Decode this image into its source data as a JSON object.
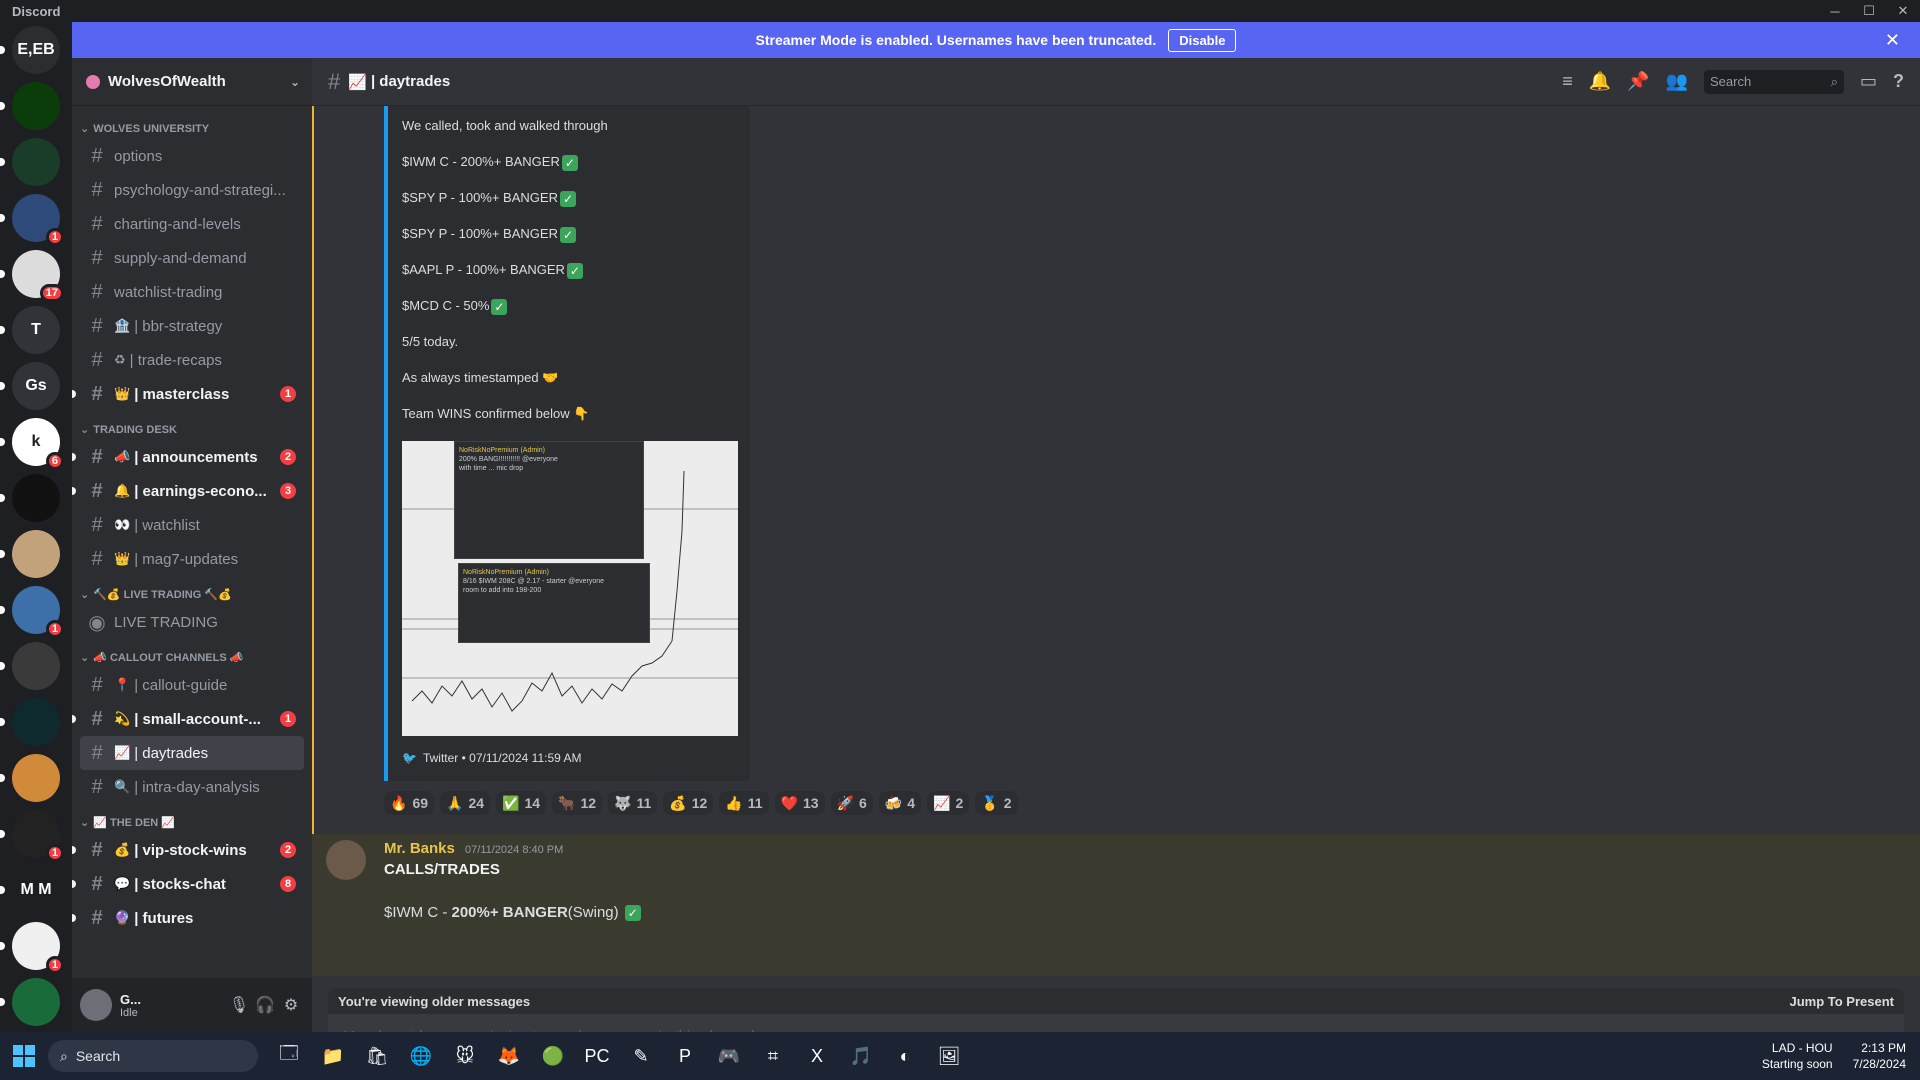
{
  "window": {
    "app_name": "Discord"
  },
  "banner": {
    "text": "Streamer Mode is enabled. Usernames have been truncated.",
    "button": "Disable"
  },
  "guilds": [
    {
      "label": "E,EB",
      "color": "#2b2d31",
      "badge": ""
    },
    {
      "label": "",
      "color": "#0b3d0b",
      "badge": ""
    },
    {
      "label": "",
      "color": "#1a3d2a",
      "badge": ""
    },
    {
      "label": "",
      "color": "#2e4a7a",
      "badge": "1"
    },
    {
      "label": "",
      "color": "#dcdcdc",
      "badge": "17"
    },
    {
      "label": "T",
      "color": "#313338",
      "badge": ""
    },
    {
      "label": "Gs",
      "color": "#313338",
      "badge": ""
    },
    {
      "label": "k",
      "color": "#ffffff",
      "badge": "6"
    },
    {
      "label": "",
      "color": "#111111",
      "badge": ""
    },
    {
      "label": "",
      "color": "#c2a27a",
      "badge": ""
    },
    {
      "label": "",
      "color": "#3d6fa8",
      "badge": "1"
    },
    {
      "label": "",
      "color": "#3a3a3a",
      "badge": ""
    },
    {
      "label": "",
      "color": "#0e2a2f",
      "badge": ""
    },
    {
      "label": "",
      "color": "#d18a3a",
      "badge": ""
    },
    {
      "label": "",
      "color": "#222222",
      "badge": "1"
    },
    {
      "label": "M M",
      "color": "#1e1f22",
      "badge": ""
    },
    {
      "label": "",
      "color": "#f0f0f0",
      "badge": "1"
    },
    {
      "label": "",
      "color": "#1a6b3a",
      "badge": ""
    }
  ],
  "server": {
    "name": "WolvesOfWealth"
  },
  "sidebar": {
    "categories": [
      {
        "name": "WOLVES UNIVERSITY",
        "channels": [
          {
            "label": "options",
            "emoji": "",
            "unread": false,
            "badge": ""
          },
          {
            "label": "psychology-and-strategi...",
            "emoji": "",
            "unread": false,
            "badge": ""
          },
          {
            "label": "charting-and-levels",
            "emoji": "",
            "unread": false,
            "badge": ""
          },
          {
            "label": "supply-and-demand",
            "emoji": "",
            "unread": false,
            "badge": ""
          },
          {
            "label": "watchlist-trading",
            "emoji": "",
            "unread": false,
            "badge": ""
          },
          {
            "label": "| bbr-strategy",
            "emoji": "🏦",
            "unread": false,
            "badge": ""
          },
          {
            "label": "| trade-recaps",
            "emoji": "♻",
            "unread": false,
            "badge": ""
          },
          {
            "label": "| masterclass",
            "emoji": "👑",
            "unread": true,
            "badge": "1"
          }
        ]
      },
      {
        "name": "TRADING DESK",
        "channels": [
          {
            "label": "| announcements",
            "emoji": "📣",
            "unread": true,
            "badge": "2"
          },
          {
            "label": "| earnings-econo...",
            "emoji": "🔔",
            "unread": true,
            "badge": "3"
          },
          {
            "label": "| watchlist",
            "emoji": "👀",
            "unread": false,
            "badge": ""
          },
          {
            "label": "| mag7-updates",
            "emoji": "👑",
            "unread": false,
            "badge": ""
          }
        ]
      },
      {
        "name": "🔨💰 LIVE TRADING 🔨💰",
        "channels": [
          {
            "label": "LIVE TRADING",
            "emoji": "",
            "unread": false,
            "badge": "",
            "voice": true
          }
        ]
      },
      {
        "name": "📣 CALLOUT CHANNELS 📣",
        "channels": [
          {
            "label": "| callout-guide",
            "emoji": "📍",
            "unread": false,
            "badge": ""
          },
          {
            "label": "| small-account-...",
            "emoji": "💫",
            "unread": true,
            "badge": "1"
          },
          {
            "label": "| daytrades",
            "emoji": "📈",
            "unread": false,
            "badge": "",
            "active": true
          },
          {
            "label": "| intra-day-analysis",
            "emoji": "🔍",
            "unread": false,
            "badge": ""
          }
        ]
      },
      {
        "name": "📈 THE DEN 📈",
        "channels": [
          {
            "label": "| vip-stock-wins",
            "emoji": "💰",
            "unread": true,
            "badge": "2"
          },
          {
            "label": "| stocks-chat",
            "emoji": "💬",
            "unread": true,
            "badge": "8"
          },
          {
            "label": "| futures",
            "emoji": "🔮",
            "unread": true,
            "badge": ""
          }
        ]
      }
    ]
  },
  "user": {
    "name": "G...",
    "status": "Idle"
  },
  "channel_header": {
    "name": "| daytrades",
    "search_placeholder": "Search"
  },
  "embed": {
    "lines": [
      "We called, took and walked through",
      "$IWM C - 200%+ BANGER",
      "$SPY P - 100%+ BANGER",
      "$SPY P - 100%+ BANGER",
      "$AAPL P - 100%+ BANGER",
      "$MCD C - 50%",
      "5/5 today.",
      "As always timestamped 🤝",
      "Team WINS confirmed below 👇"
    ],
    "checks": [
      false,
      true,
      true,
      true,
      true,
      true,
      false,
      false,
      false
    ],
    "shot1_author": "NoRiskNoPremium (Admin)",
    "shot1_text": "200% BANG!!!!!!!!!!! @everyone",
    "shot1_sub": "with time ... mic drop",
    "shot2_author": "NoRiskNoPremium (Admin)",
    "shot2_text": "8/16 $IWM 208C @ 2.17 - starter @everyone",
    "shot2_sub": "room to add into 198-200",
    "footer": "Twitter • 07/11/2024 11:59 AM"
  },
  "reactions": [
    {
      "emoji": "🔥",
      "count": "69"
    },
    {
      "emoji": "🙏",
      "count": "24"
    },
    {
      "emoji": "✅",
      "count": "14"
    },
    {
      "emoji": "🐂",
      "count": "12"
    },
    {
      "emoji": "🐺",
      "count": "11"
    },
    {
      "emoji": "💰",
      "count": "12"
    },
    {
      "emoji": "👍",
      "count": "11"
    },
    {
      "emoji": "❤️",
      "count": "13"
    },
    {
      "emoji": "🚀",
      "count": "6"
    },
    {
      "emoji": "🍻",
      "count": "4"
    },
    {
      "emoji": "📈",
      "count": "2"
    },
    {
      "emoji": "🥇",
      "count": "2"
    }
  ],
  "message2": {
    "author": "Mr. Banks",
    "timestamp": "07/11/2024 8:40 PM",
    "line1": "CALLS/TRADES",
    "line2_prefix": "$IWM C - ",
    "line2_bold": "200%+ BANGER",
    "line2_suffix": "(Swing)"
  },
  "older_bar": {
    "text": "You're viewing older messages",
    "jump": "Jump To Present"
  },
  "input": {
    "placeholder": "You do not have permission to send messages in this channel."
  },
  "taskbar": {
    "search": "Search",
    "apps": [
      "🗔",
      "📁",
      "🛍",
      "🌐",
      "🐭",
      "🦊",
      "🟢",
      "PC",
      "✎",
      "P",
      "🎮",
      "⌗",
      "X",
      "🎵",
      "◐",
      "🖼"
    ],
    "weather_title": "LAD - HOU",
    "weather_sub": "Starting soon",
    "time": "2:13 PM",
    "date": "7/28/2024"
  }
}
